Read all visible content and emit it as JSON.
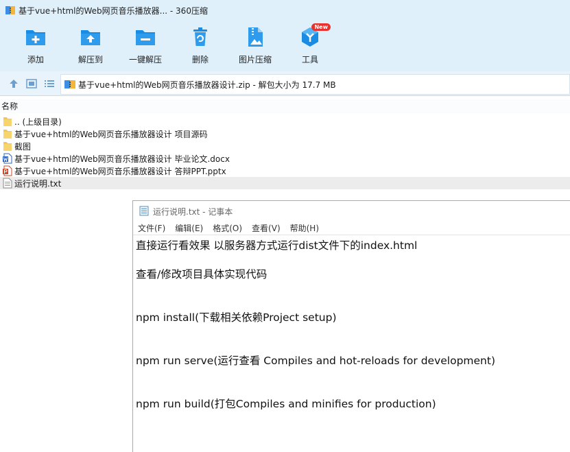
{
  "window": {
    "title": "基于vue+html的Web网页音乐播放器... - 360压缩"
  },
  "toolbar": {
    "items": [
      {
        "label": "添加",
        "icon": "add-folder-icon"
      },
      {
        "label": "解压到",
        "icon": "extract-to-icon"
      },
      {
        "label": "一键解压",
        "icon": "one-click-extract-icon"
      },
      {
        "label": "删除",
        "icon": "delete-icon"
      },
      {
        "label": "图片压缩",
        "icon": "image-compress-icon"
      },
      {
        "label": "工具",
        "icon": "tools-icon",
        "badge": "New"
      }
    ]
  },
  "address": {
    "path": "基于vue+html的Web网页音乐播放器设计.zip - 解包大小为 17.7 MB"
  },
  "file_list": {
    "header": "名称",
    "rows": [
      {
        "name": ".. (上级目录)",
        "icon": "folder-icon"
      },
      {
        "name": "基于vue+html的Web网页音乐播放器设计 项目源码",
        "icon": "folder-icon"
      },
      {
        "name": "截图",
        "icon": "folder-icon"
      },
      {
        "name": "基于vue+html的Web网页音乐播放器设计 毕业论文.docx",
        "icon": "word-document-icon"
      },
      {
        "name": "基于vue+html的Web网页音乐播放器设计 答辩PPT.pptx",
        "icon": "powerpoint-icon"
      },
      {
        "name": "运行说明.txt",
        "icon": "text-file-icon",
        "selected": true
      }
    ]
  },
  "notepad": {
    "title": "运行说明.txt - 记事本",
    "menu": [
      "文件(F)",
      "编辑(E)",
      "格式(O)",
      "查看(V)",
      "帮助(H)"
    ],
    "lines": [
      "直接运行看效果 以服务器方式运行dist文件下的index.html",
      "查看/修改项目具体实现代码",
      "npm install(下载相关依赖Project setup)",
      "npm run serve(运行查看 Compiles and hot-reloads for development)",
      "npm run build(打包Compiles and minifies for production)"
    ]
  },
  "colors": {
    "toolbar_bg": "#dff0fb",
    "icon_blue": "#1b8ce3",
    "badge_red": "#e8322f",
    "selection": "#ececec"
  }
}
